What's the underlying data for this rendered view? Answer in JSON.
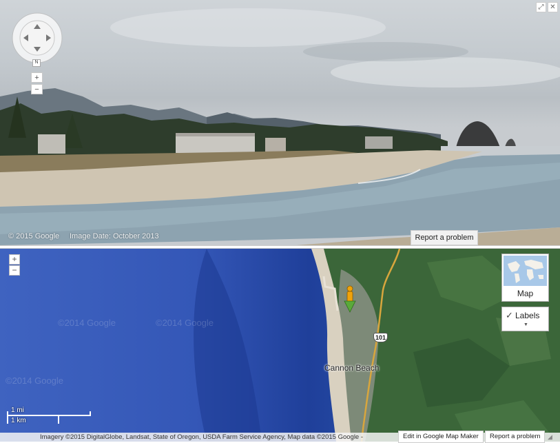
{
  "street_view": {
    "zoom_in_label": "+",
    "zoom_out_label": "−",
    "compass_north": "N",
    "expand_icon": "⤢",
    "close_icon": "✕",
    "copyright": "© 2015 Google",
    "image_date": "Image Date: October 2013",
    "report_label": "Report a problem"
  },
  "map": {
    "zoom_in_label": "+",
    "zoom_out_label": "−",
    "map_type_label": "Map",
    "labels_check": "✓",
    "labels_label": "Labels",
    "labels_caret": "▼",
    "place_label": "Cannon Beach",
    "highway_shield": "101",
    "watermark": "©2014 Google",
    "scale_mi": "1 mi",
    "scale_km": "1 km",
    "attribution": "Imagery ©2015 DigitalGlobe, Landsat, State of Oregon, USDA Farm Service Agency, Map data ©2015 Google -",
    "edit_link": "Edit in Google Map Maker",
    "report_label": "Report a problem",
    "resize_icon": "◢"
  },
  "colors": {
    "ocean_deep": "#2f56b8",
    "ocean_shallow": "#4b72c6",
    "forest": "#3d6a3a",
    "road": "#e0b14a",
    "pegman": "#f0a30a",
    "marker": "#5aa93a"
  }
}
